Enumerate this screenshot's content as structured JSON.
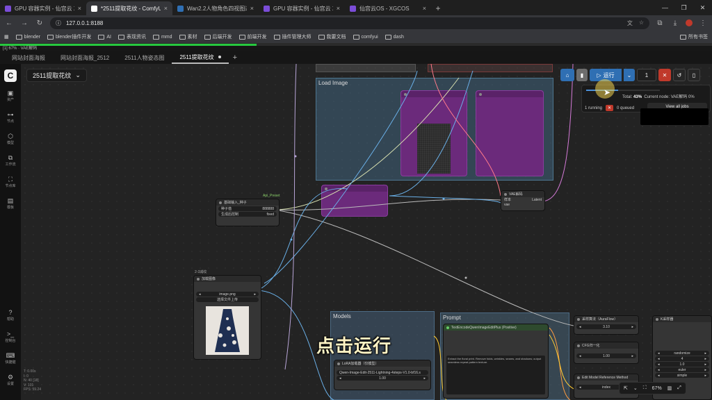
{
  "browser": {
    "tabs": [
      {
        "title": "GPU 容器实例 - 仙宫云 Xiangong",
        "color": "#7b4dd8",
        "active": false
      },
      {
        "title": "*2511提取花纹 - ComfyUI",
        "color": "#ffffff",
        "active": true
      },
      {
        "title": "Wan2.2人物角色四视图通用 -",
        "color": "#2f6fb3",
        "active": false
      },
      {
        "title": "GPU 容器实例 - 仙宫云 Xiangong",
        "color": "#7b4dd8",
        "active": false
      },
      {
        "title": "仙宫云OS - XGCOS",
        "color": "#7b4dd8",
        "active": false
      }
    ],
    "url": "127.0.0.1:8188",
    "bookmarks": [
      "blender",
      "blender插件开发",
      "AI",
      "表现资讯",
      "mmd",
      "素材",
      "后端开发",
      "前端开发",
      "插件管理大师",
      "我要文档",
      "comfyui",
      "dash"
    ],
    "bookmarks_right": "所有书签"
  },
  "status": {
    "line": "[1] 67% · VAE解码",
    "progress": 0.36
  },
  "workflow_tabs": [
    {
      "label": "网站封面海报"
    },
    {
      "label": "网站封面海报_2512"
    },
    {
      "label": "2511人物姿态图"
    },
    {
      "label": "2511提取花纹",
      "active": true
    }
  ],
  "sidebar": {
    "items": [
      {
        "icon": "image-icon",
        "label": "资产"
      },
      {
        "icon": "node-icon",
        "label": "节点"
      },
      {
        "icon": "model-icon",
        "label": "模型"
      },
      {
        "icon": "workflow-icon",
        "label": "工作流"
      },
      {
        "icon": "library-icon",
        "label": "节点库"
      },
      {
        "icon": "template-icon",
        "label": "模板"
      }
    ],
    "bottom": [
      {
        "icon": "help-icon",
        "label": "帮助"
      },
      {
        "icon": "terminal-icon",
        "label": "控制台"
      },
      {
        "icon": "keyboard-icon",
        "label": "快捷键"
      },
      {
        "icon": "settings-icon",
        "label": "设置"
      }
    ]
  },
  "canvas": {
    "workflow_name": "2511提取花纹",
    "groups": {
      "load_image": "Load Image",
      "models": "Models",
      "prompt": "Prompt"
    },
    "nodes": {
      "seed_title": "基础输入_种子",
      "seed_badge": "Api_Preset",
      "seed_row1_label": "种子值",
      "seed_row1_value": "888888",
      "seed_row2_label": "生成后控制",
      "seed_row2_value": "fixed",
      "load_label": "2-3减纹",
      "load_title": "加载图像",
      "load_file": "image.png",
      "load_upload": "选择文件上传",
      "vae_title": "VAE解码",
      "vae_in1": "样本",
      "vae_in2": "vae",
      "vae_out": "Latent",
      "lora_title": "LoRA加载器（仅模型）",
      "lora_model": "Qwen-Image-Edit-2511-Lightning-4steps-V1.0-bf16.s",
      "lora_strength": "1.00",
      "prompt_title": "TextEncodeQwenImageEditPlus (Positive)",
      "prompt_text": "Extract the floral print. Remove folds, wrinkles, seams, and shadows; output seamless repeat pattern texture.",
      "sampler_title": "采样算法（AuraFlow）",
      "sampler_value": "3.10",
      "cfg_title": "CFG归一化",
      "cfg_value": "1.00",
      "ref_title": "Edit Model Reference Method",
      "ref_value": "index",
      "ksampler_title": "K采样器",
      "ksampler_rows": [
        "randomize",
        "4",
        "1.0",
        "euler",
        "simple"
      ]
    },
    "caption": "点击运行",
    "stats": [
      "T: 0.00s",
      "I: 0",
      "N: 40 [18]",
      "V: 101",
      "FPS: 59.24"
    ]
  },
  "toolbar": {
    "run_label": "运行",
    "batch_count": "1"
  },
  "queue": {
    "progress": 0.43,
    "total_label": "Total:",
    "total_value": "43%",
    "current_label": "Current node:",
    "current_node": "VAE解码",
    "current_pct": "0%",
    "running": "1 running",
    "queued": "0 queued",
    "all_jobs": "View all jobs"
  },
  "zoom": "67%",
  "colors": {
    "accent": "#2f6fb3",
    "stop": "#c0392b",
    "progress": "#27c93f",
    "node_purple": "#6b2a7b"
  }
}
